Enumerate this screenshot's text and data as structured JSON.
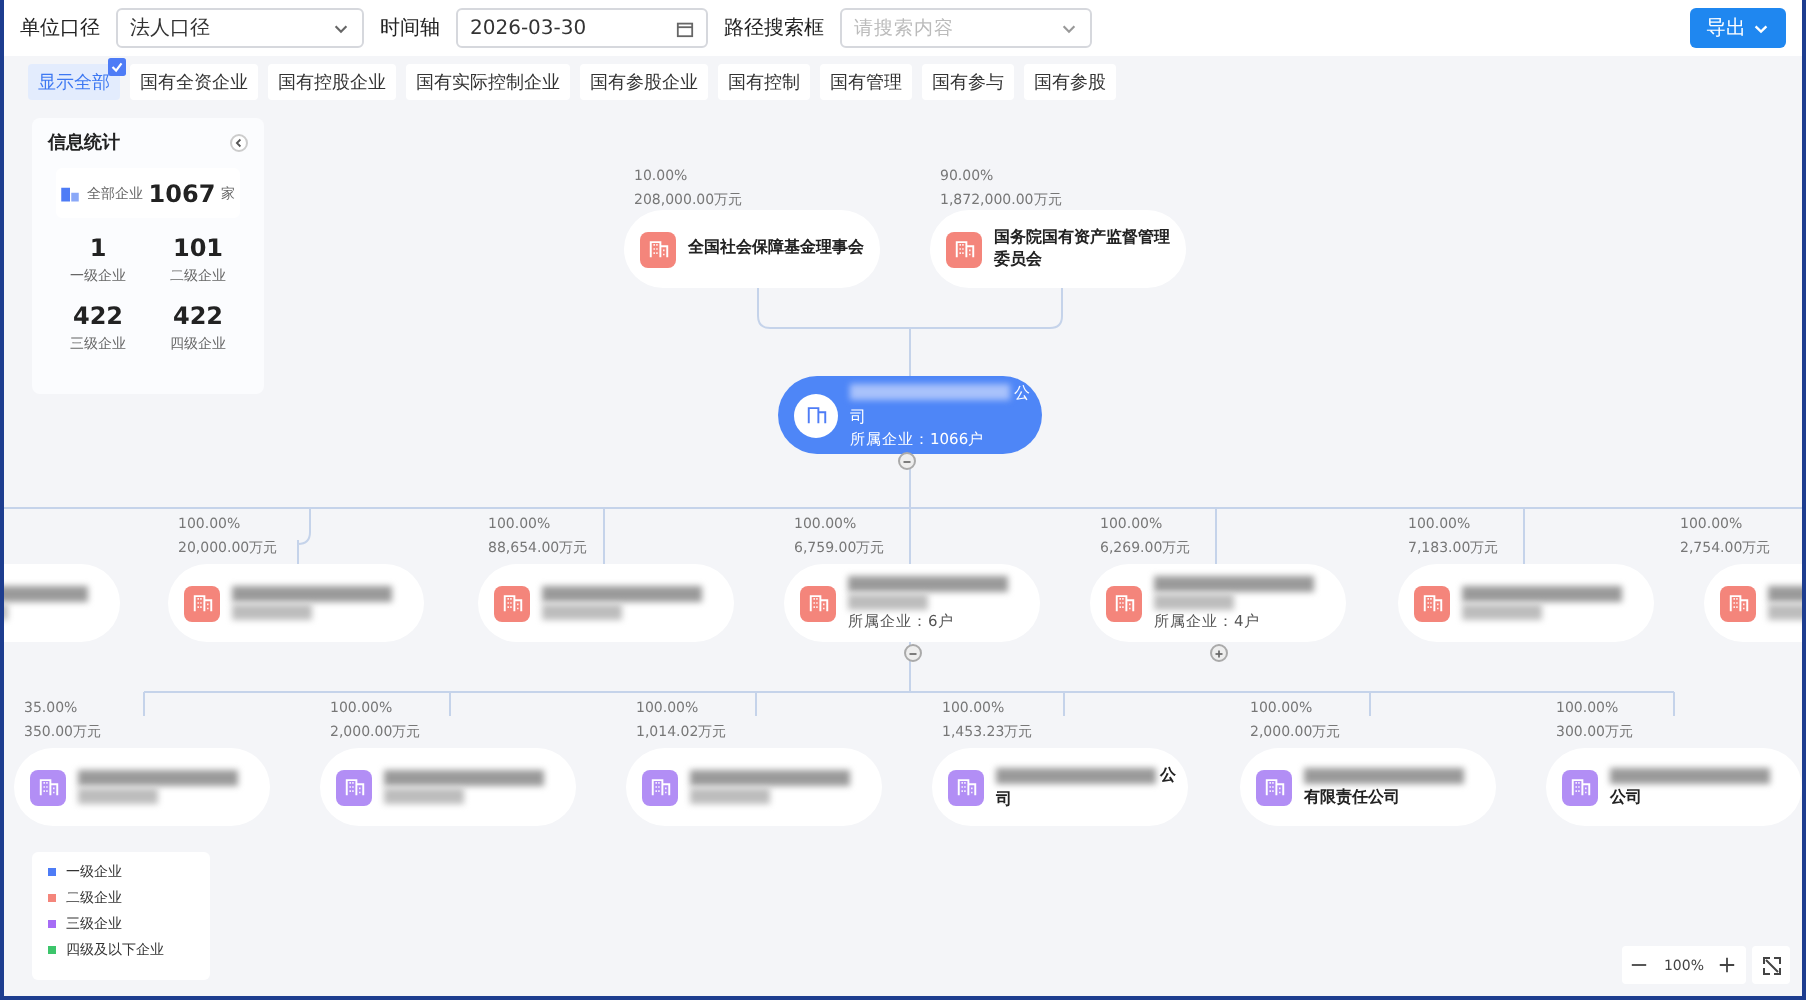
{
  "filters": {
    "unit_label": "单位口径",
    "unit_value": "法人口径",
    "time_label": "时间轴",
    "date": "2026-03-30",
    "search_label": "路径搜索框",
    "search_placeholder": "请搜索内容",
    "export": "导出"
  },
  "tags": [
    {
      "label": "显示全部",
      "selected": true
    },
    {
      "label": "国有全资企业",
      "selected": false
    },
    {
      "label": "国有控股企业",
      "selected": false
    },
    {
      "label": "国有实际控制企业",
      "selected": false
    },
    {
      "label": "国有参股企业",
      "selected": false
    },
    {
      "label": "国有控制",
      "selected": false
    },
    {
      "label": "国有管理",
      "selected": false
    },
    {
      "label": "国有参与",
      "selected": false
    },
    {
      "label": "国有参股",
      "selected": false
    }
  ],
  "stats": {
    "title": "信息统计",
    "total_label": "全部企业",
    "total": "1067",
    "total_unit": "家",
    "levels": [
      {
        "value": "1",
        "label": "一级企业"
      },
      {
        "value": "101",
        "label": "二级企业"
      },
      {
        "value": "422",
        "label": "三级企业"
      },
      {
        "value": "422",
        "label": "四级企业"
      }
    ]
  },
  "shareholders": [
    {
      "pct": "10.00%",
      "amount": "208,000.00万元",
      "name": "全国社会保障基金理事会",
      "color": "#f4857b"
    },
    {
      "pct": "90.00%",
      "amount": "1,872,000.00万元",
      "name": "国务院国有资产监督管理委员会",
      "color": "#f4857b"
    }
  ],
  "root": {
    "name_end": "公",
    "name_line2": "司",
    "subsidiaries": "所属企业：1066户",
    "expanded": true
  },
  "level2": [
    {
      "kind": "clipped"
    },
    {
      "kind": "full",
      "pct": "100.00%",
      "amount": "20,000.00万元",
      "color": "#f4857b"
    },
    {
      "kind": "full",
      "pct": "100.00%",
      "amount": "88,654.00万元",
      "color": "#f4857b"
    },
    {
      "kind": "full",
      "pct": "100.00%",
      "amount": "6,759.00万元",
      "color": "#f4857b",
      "subsidiaries": "所属企业：6户",
      "expanded": true
    },
    {
      "kind": "full",
      "pct": "100.00%",
      "amount": "6,269.00万元",
      "color": "#f4857b",
      "subsidiaries": "所属企业：4户",
      "expanded": false
    },
    {
      "kind": "full",
      "pct": "100.00%",
      "amount": "7,183.00万元",
      "color": "#f4857b"
    },
    {
      "kind": "full",
      "pct": "100.00%",
      "amount": "2,754.00万元",
      "color": "#f4857b"
    }
  ],
  "level3": [
    {
      "pct": "35.00%",
      "amount": "350.00万元",
      "color": "#b28ef5"
    },
    {
      "pct": "100.00%",
      "amount": "2,000.00万元",
      "color": "#b28ef5"
    },
    {
      "pct": "100.00%",
      "amount": "1,014.02万元",
      "color": "#b28ef5"
    },
    {
      "pct": "100.00%",
      "amount": "1,453.23万元",
      "color": "#b28ef5",
      "name_end": "公",
      "name_line2": "司"
    },
    {
      "pct": "100.00%",
      "amount": "2,000.00万元",
      "color": "#b28ef5",
      "name_line2": "有限责任公司"
    },
    {
      "pct": "100.00%",
      "amount": "300.00万元",
      "color": "#b28ef5",
      "name_line2": "公司"
    }
  ],
  "legend": [
    {
      "label": "一级企业",
      "color": "#4e7cf6"
    },
    {
      "label": "二级企业",
      "color": "#f4857b"
    },
    {
      "label": "三级企业",
      "color": "#a66cf5"
    },
    {
      "label": "四级及以下企业",
      "color": "#3cc56b"
    }
  ],
  "zoom": {
    "value": "100%"
  }
}
